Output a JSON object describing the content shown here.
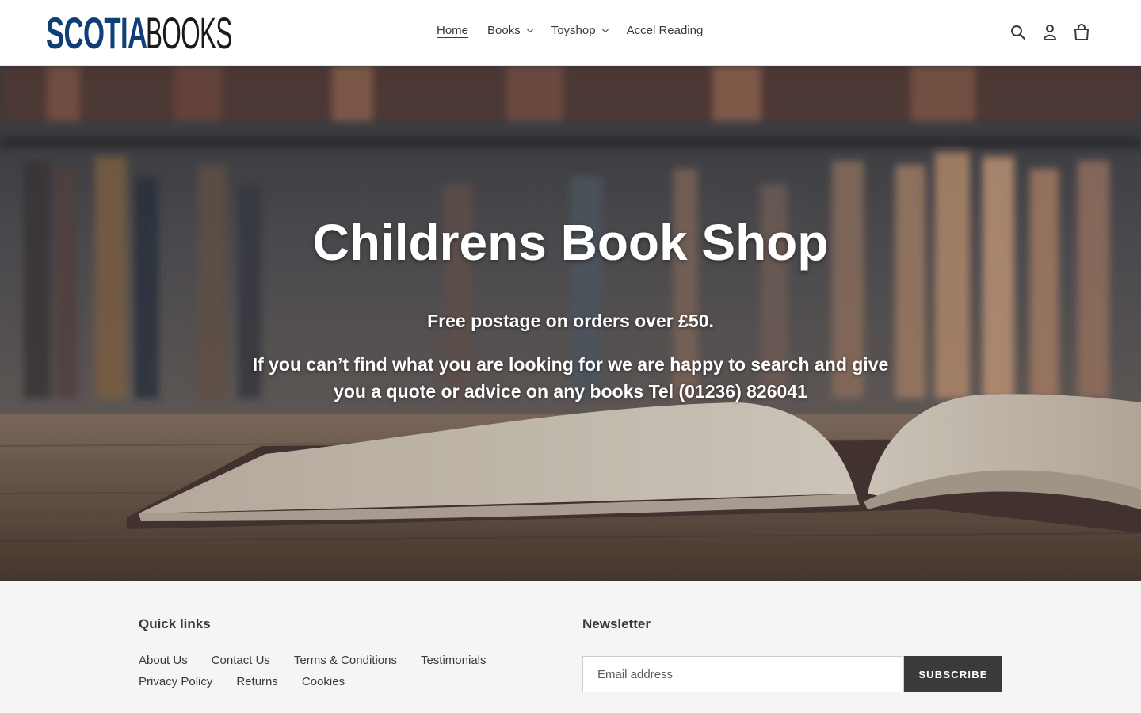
{
  "header": {
    "logo": {
      "part1": "SCOTIA",
      "part2": "BOOKS"
    },
    "nav": [
      {
        "label": "Home",
        "active": true,
        "has_dropdown": false
      },
      {
        "label": "Books",
        "active": false,
        "has_dropdown": true
      },
      {
        "label": "Toyshop",
        "active": false,
        "has_dropdown": true
      },
      {
        "label": "Accel Reading",
        "active": false,
        "has_dropdown": false
      }
    ],
    "icons": [
      "search-icon",
      "account-icon",
      "cart-icon"
    ]
  },
  "hero": {
    "title": "Childrens Book Shop",
    "line1": "Free postage on orders over £50.",
    "line2": "If you can’t find what you are looking for we are happy to search and give you a quote or advice on any books Tel (01236) 826041"
  },
  "footer": {
    "quick_links": {
      "heading": "Quick links",
      "links": [
        "About Us",
        "Contact Us",
        "Terms & Conditions",
        "Testimonials",
        "Privacy Policy",
        "Returns",
        "Cookies"
      ]
    },
    "newsletter": {
      "heading": "Newsletter",
      "email_placeholder": "Email address",
      "subscribe_label": "SUBSCRIBE"
    }
  },
  "colors": {
    "brand_blue": "#0f3f78",
    "text": "#3a3a3a",
    "button_bg": "#3a3a3a",
    "footer_bg": "#f5f5f5"
  }
}
